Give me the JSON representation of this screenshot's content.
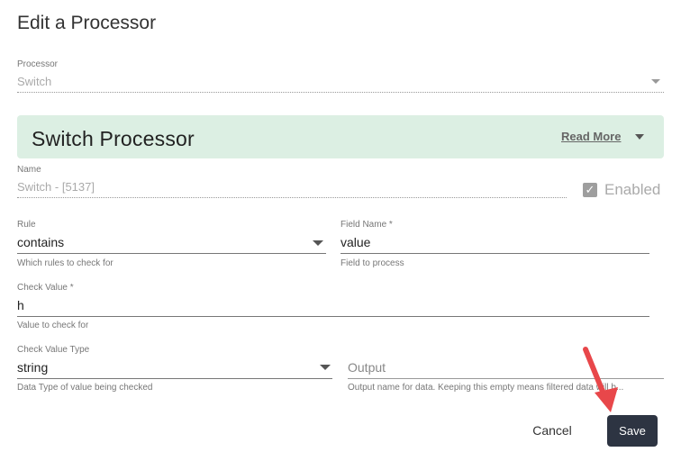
{
  "dialog": {
    "title": "Edit a Processor"
  },
  "processor": {
    "label": "Processor",
    "value": "Switch"
  },
  "banner": {
    "title": "Switch Processor",
    "read_more": "Read More"
  },
  "name": {
    "label": "Name",
    "value": "Switch  - [5137]"
  },
  "enabled": {
    "label": "Enabled",
    "checked": true
  },
  "rule": {
    "label": "Rule",
    "value": "contains",
    "helper": "Which rules to check for"
  },
  "field_name": {
    "label": "Field Name *",
    "value": "value",
    "helper": "Field to process"
  },
  "check_value": {
    "label": "Check Value *",
    "value": "h",
    "helper": "Value to check for"
  },
  "check_value_type": {
    "label": "Check Value Type",
    "value": "string",
    "helper": "Data Type of value being checked"
  },
  "output": {
    "placeholder": "Output",
    "helper": "Output name for data. Keeping this empty means filtered data will b..."
  },
  "actions": {
    "cancel": "Cancel",
    "save": "Save"
  },
  "colors": {
    "banner_bg": "#dcefe3",
    "save_bg": "#2d3442",
    "arrow": "#e8474a"
  }
}
